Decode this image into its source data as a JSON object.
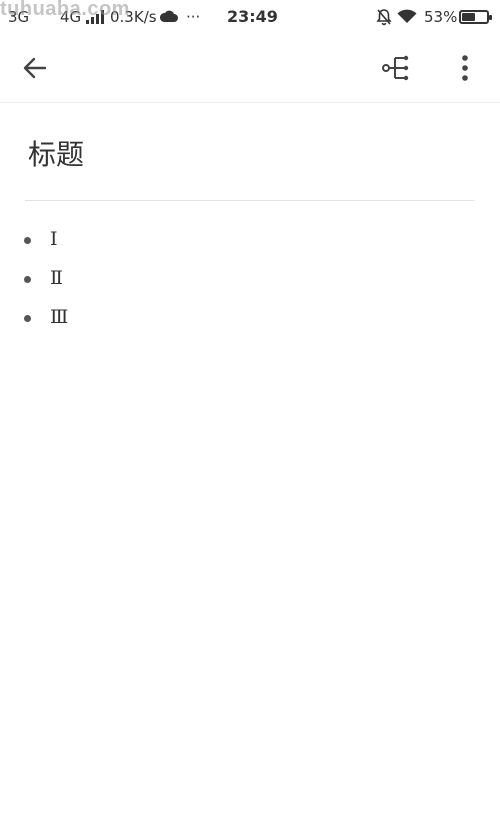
{
  "status_bar": {
    "watermark": "tuhuaba.com",
    "net1": "3G",
    "net2": "4G",
    "speed": "0.3K/s",
    "more": "···",
    "time": "23:49",
    "battery_percent": "53%",
    "battery_level": 0.53,
    "icons": [
      "signal-bars-icon",
      "cloud-icon",
      "bell-muted-icon",
      "wifi-icon",
      "battery-icon"
    ]
  },
  "toolbar": {
    "icons": [
      "back-arrow-icon",
      "mind-map-icon",
      "more-vert-icon"
    ]
  },
  "note": {
    "title": "标题",
    "items": [
      {
        "label": "Ⅰ"
      },
      {
        "label": "Ⅱ"
      },
      {
        "label": "Ⅲ"
      }
    ]
  },
  "colors": {
    "background": "#ffffff",
    "text": "#333333",
    "divider": "#e2e2e2"
  }
}
